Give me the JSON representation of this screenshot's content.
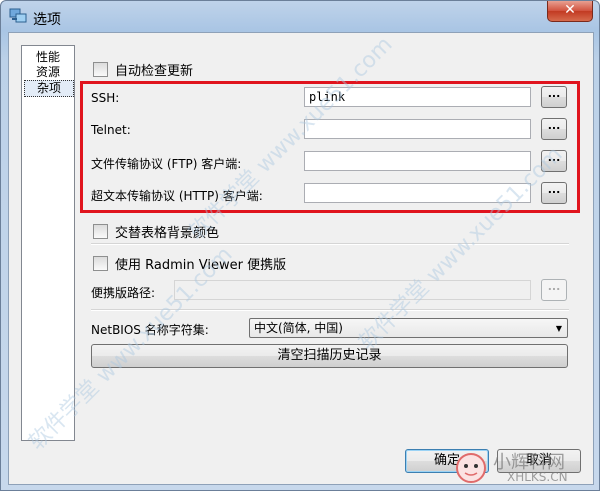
{
  "window": {
    "title": "选项",
    "close_glyph": "✕"
  },
  "sidebar": {
    "items": [
      {
        "label": "性能"
      },
      {
        "label": "资源"
      },
      {
        "label": "杂项"
      }
    ],
    "selected": "杂项"
  },
  "settings": {
    "auto_update": {
      "label": "自动检查更新",
      "checked": false
    },
    "ssh": {
      "label": "SSH:",
      "value": "plink"
    },
    "telnet": {
      "label": "Telnet:",
      "value": ""
    },
    "ftp": {
      "label": "文件传输协议 (FTP) 客户端:",
      "value": ""
    },
    "http": {
      "label": "超文本传输协议 (HTTP) 客户端:",
      "value": ""
    },
    "browse_label": "...",
    "alt_row_colors": {
      "label": "交替表格背景颜色",
      "checked": false
    },
    "radmin": {
      "label": "使用 Radmin Viewer 便携版",
      "checked": false
    },
    "portable_path": {
      "label": "便携版路径:",
      "value": ""
    },
    "netbios": {
      "label": "NetBIOS 名称字符集:",
      "selected": "中文(简体, 中国)"
    },
    "clear_history": "清空扫描历史记录"
  },
  "footer": {
    "ok": "确定",
    "cancel": "取消"
  },
  "watermark": {
    "text": "软件学堂 www.xue51.com",
    "logo_text": "小辉科网",
    "logo_sub": "XHLKS.CN"
  },
  "colors": {
    "highlight": "#e0141e",
    "title_gradient": "#a9c5e4"
  }
}
